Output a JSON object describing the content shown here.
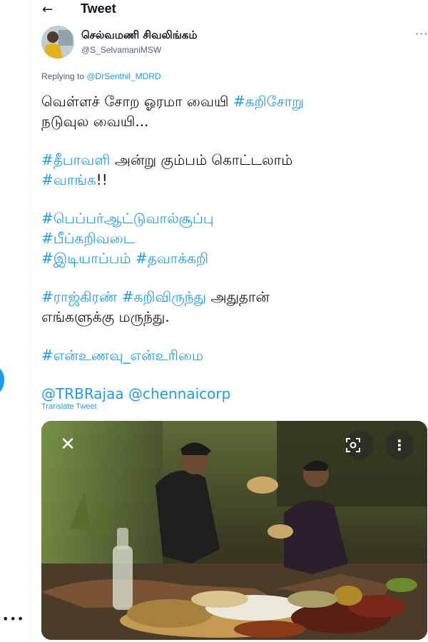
{
  "header": {
    "title": "Tweet",
    "back_icon": "arrow-left-icon"
  },
  "tweet": {
    "author": {
      "display_name": "செல்வமணி சிவலிங்கம்",
      "handle": "@S_SelvamaniMSW"
    },
    "reply": {
      "prefix": "Replying to ",
      "to": "@DrSenthil_MDRD"
    },
    "body": {
      "l1a": "வெள்ளச் சோற ஓரமா வையி ",
      "l1tag": "#கறிசோறு",
      "l2": "நடுவுல வையி...",
      "l3tag": "#தீபாவளி",
      "l3rest": " அன்று கும்பம் கொட்டலாம்",
      "l4tag": "#வாங்க",
      "l4rest": "!!",
      "l5tag": "#பெப்பர்ஆட்டுவால்சூப்பு",
      "l6tag": "#பீப்கறிவடை",
      "l7tag1": "#இடியாப்பம்",
      "l7tag2": "#தவாக்கறி",
      "l8tag1": "#ராஜ்கிரண்",
      "l8tag2": "#கறிவிருந்து",
      "l8rest": " அதுதான்",
      "l9": "எங்களுக்கு மருந்து.",
      "l10tag": "#என்உணவு_என்உரிமை",
      "m1": "@TRBRajaa",
      "m2": "@chennaicorp"
    },
    "translate_label": "Translate Tweet"
  },
  "media": {
    "close_icon": "close-icon",
    "lens_icon": "lens-search-icon",
    "more_icon": "vertical-dots-icon"
  },
  "colors": {
    "link": "#1d9bf0",
    "text": "#0f1419",
    "secondary": "#536471"
  }
}
